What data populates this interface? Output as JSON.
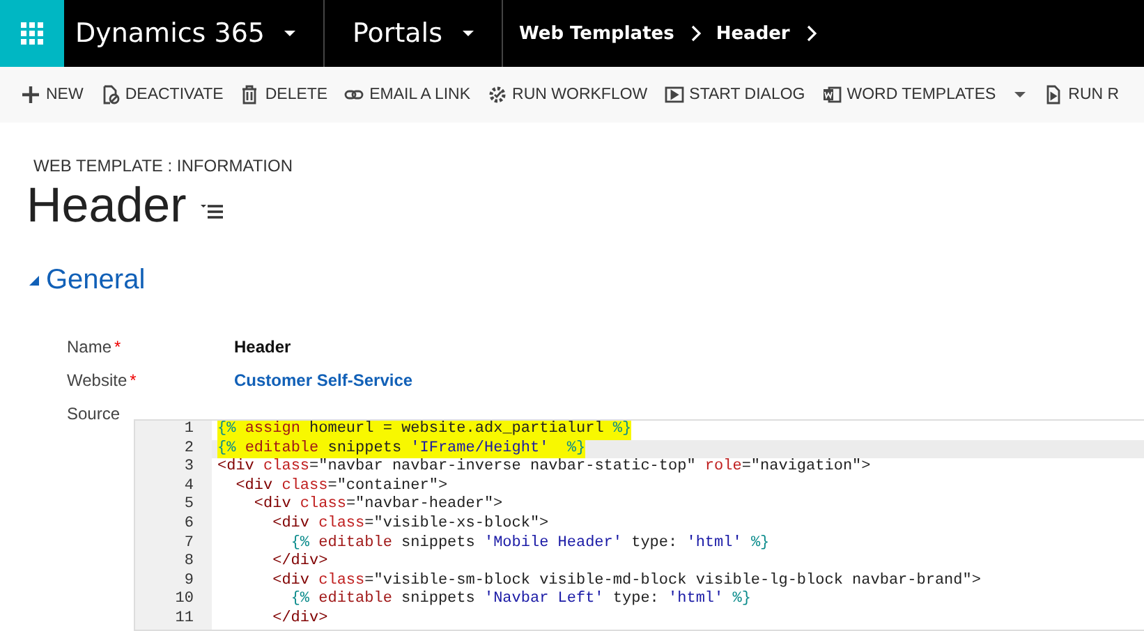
{
  "nav_bar": {
    "app_name": "Dynamics 365",
    "area": "Portals",
    "breadcrumbs": [
      "Web Templates",
      "Header"
    ]
  },
  "toolbar": [
    {
      "kind": "new",
      "label": "NEW"
    },
    {
      "kind": "deactivate",
      "label": "DEACTIVATE"
    },
    {
      "kind": "delete",
      "label": "DELETE"
    },
    {
      "kind": "email",
      "label": "EMAIL A LINK"
    },
    {
      "kind": "workflow",
      "label": "RUN WORKFLOW"
    },
    {
      "kind": "dialog",
      "label": "START DIALOG"
    },
    {
      "kind": "word",
      "label": "WORD TEMPLATES",
      "dropdown": true
    },
    {
      "kind": "report",
      "label": "RUN R"
    }
  ],
  "record": {
    "entity_label": "WEB TEMPLATE : INFORMATION",
    "title": "Header"
  },
  "section": {
    "title": "General",
    "expanded": true
  },
  "fields": [
    {
      "label": "Name",
      "required_mark": "*",
      "value": "Header",
      "kind": "text"
    },
    {
      "label": "Website",
      "required_mark": "*",
      "value": "Customer Self-Service",
      "kind": "lookup"
    },
    {
      "label": "Source",
      "kind": "code"
    }
  ],
  "code_lines": [
    {
      "number": "1",
      "text": "{% assign homeurl = website.adx_partialurl %}",
      "highlighted": true,
      "current": false
    },
    {
      "number": "2",
      "text": "{% editable snippets 'IFrame/Height'  %}",
      "highlighted": true,
      "current": true
    },
    {
      "number": "3",
      "text": "<div class=\"navbar navbar-inverse navbar-static-top\" role=\"navigation\">",
      "highlighted": false,
      "current": false
    },
    {
      "number": "4",
      "text": "  <div class=\"container\">",
      "highlighted": false,
      "current": false
    },
    {
      "number": "5",
      "text": "    <div class=\"navbar-header\">",
      "highlighted": false,
      "current": false
    },
    {
      "number": "6",
      "text": "      <div class=\"visible-xs-block\">",
      "highlighted": false,
      "current": false
    },
    {
      "number": "7",
      "text": "        {% editable snippets 'Mobile Header' type: 'html' %}",
      "highlighted": false,
      "current": false
    },
    {
      "number": "8",
      "text": "      </div>",
      "highlighted": false,
      "current": false
    },
    {
      "number": "9",
      "text": "      <div class=\"visible-sm-block visible-md-block visible-lg-block navbar-brand\">",
      "highlighted": false,
      "current": false
    },
    {
      "number": "10",
      "text": "        {% editable snippets 'Navbar Left' type: 'html' %}",
      "highlighted": false,
      "current": false
    },
    {
      "number": "11",
      "text": "      </div>",
      "highlighted": false,
      "current": false
    }
  ]
}
